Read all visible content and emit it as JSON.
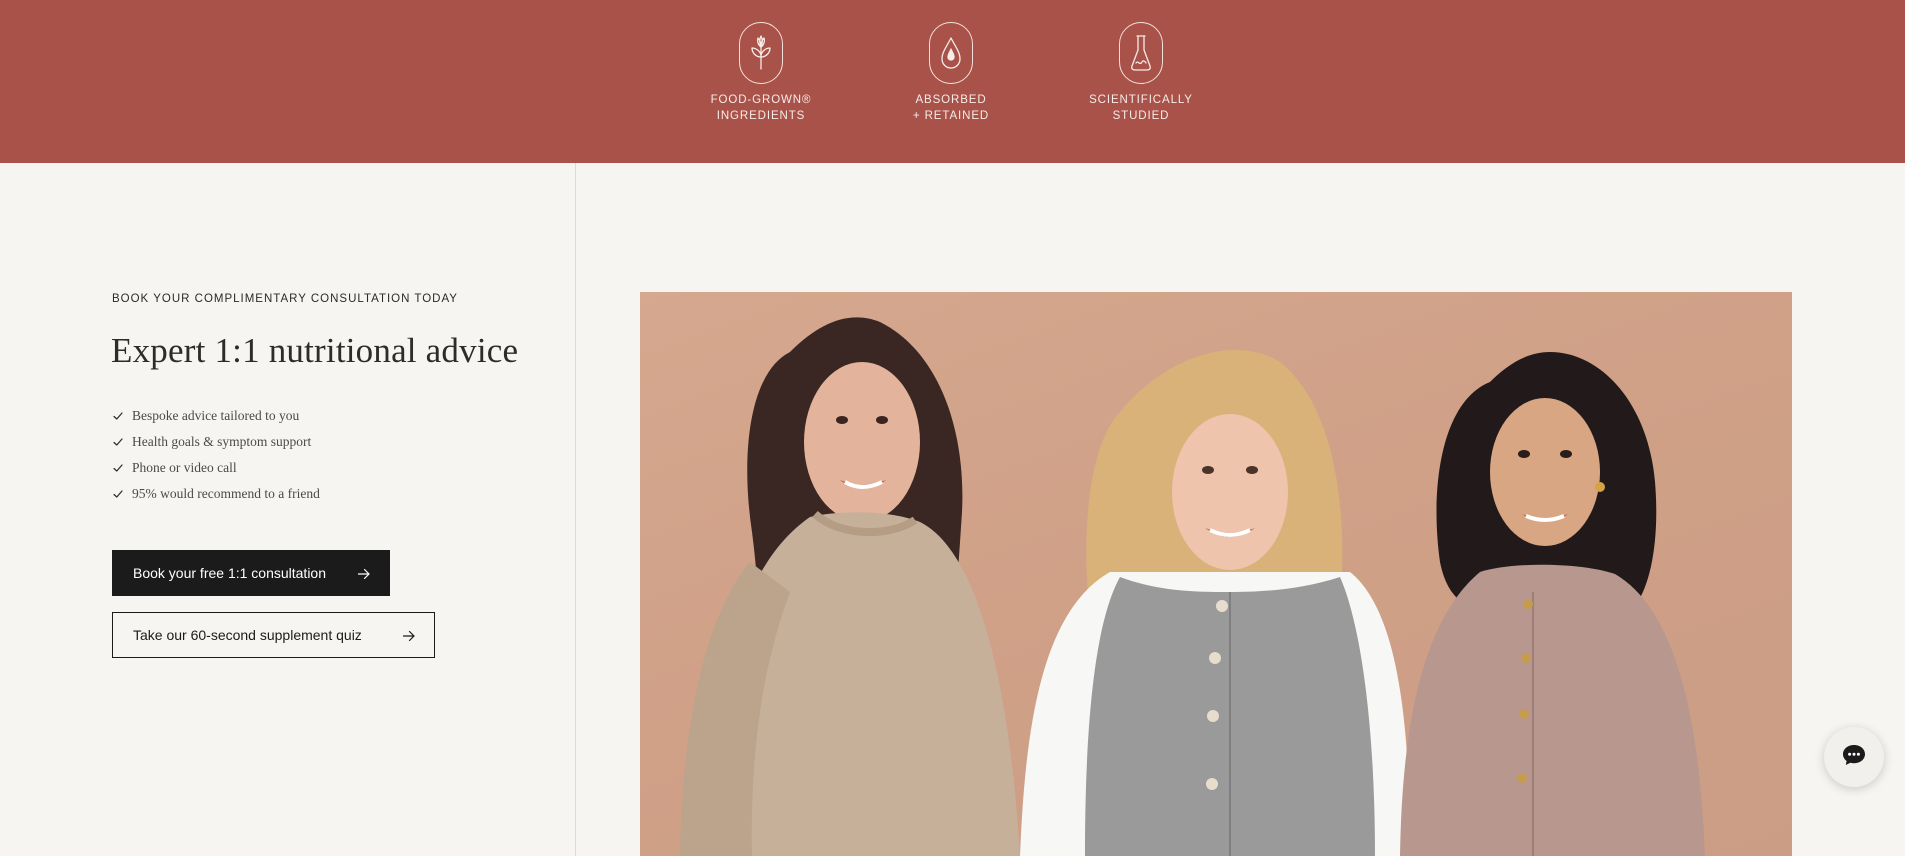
{
  "colors": {
    "band_background": "#a85249",
    "page_background": "#f7f5f1",
    "primary_button": "#1b1b1b",
    "photo_backdrop": "#d2a58c"
  },
  "benefits": [
    {
      "icon": "flower-icon",
      "caption": "FOOD-GROWN®\nINGREDIENTS"
    },
    {
      "icon": "droplet-icon",
      "caption": "ABSORBED\n+ RETAINED"
    },
    {
      "icon": "flask-icon",
      "caption": "SCIENTIFICALLY\nSTUDIED"
    }
  ],
  "consultation": {
    "eyebrow": "BOOK YOUR COMPLIMENTARY CONSULTATION TODAY",
    "headline": "Expert 1:1 nutritional advice",
    "points": [
      "Bespoke advice tailored to you",
      "Health goals & symptom support",
      "Phone or video call",
      "95% would recommend to a friend"
    ],
    "primary_cta": "Book your free 1:1 consultation",
    "secondary_cta": "Take our 60-second supplement quiz"
  },
  "photo": {
    "subject": "three-smiling-women"
  },
  "chat": {
    "icon": "chat-bubble-icon"
  }
}
